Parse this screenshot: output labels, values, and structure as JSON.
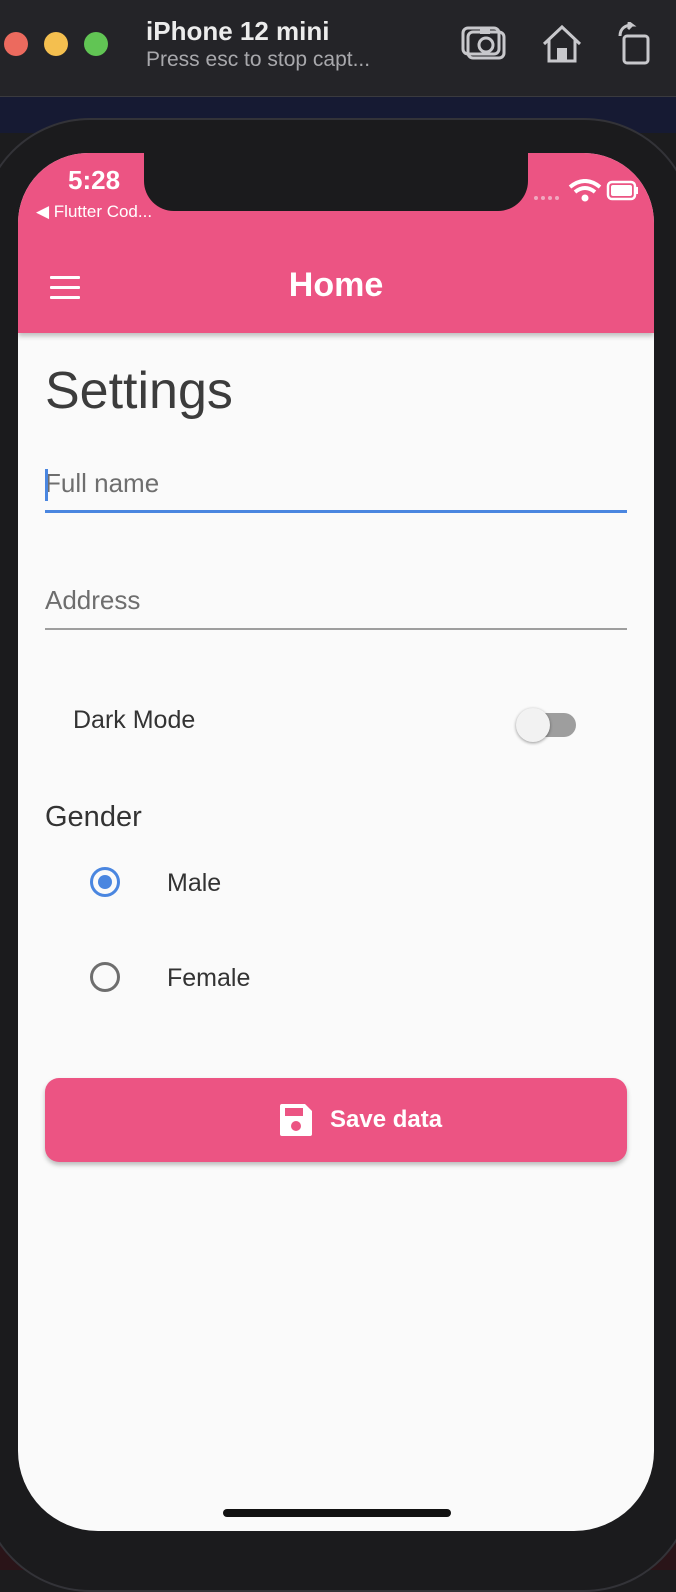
{
  "simulator": {
    "device_name": "iPhone 12 mini",
    "subtitle": "Press esc to stop capt...",
    "icons": [
      "screenshot-icon",
      "home-icon",
      "rotate-icon"
    ]
  },
  "status_bar": {
    "time": "5:28",
    "back_label": "◀ Flutter Cod...",
    "icons": [
      "wifi-icon",
      "battery-icon"
    ]
  },
  "app_bar": {
    "title": "Home",
    "menu_icon": "menu-icon",
    "color": "#ec5483"
  },
  "page": {
    "title": "Settings"
  },
  "form": {
    "full_name": {
      "placeholder": "Full name",
      "value": ""
    },
    "address": {
      "placeholder": "Address",
      "value": ""
    },
    "dark_mode": {
      "label": "Dark Mode",
      "enabled": false
    },
    "gender": {
      "label": "Gender",
      "options": [
        {
          "label": "Male",
          "selected": true
        },
        {
          "label": "Female",
          "selected": false
        }
      ]
    },
    "save_button": {
      "label": "Save data",
      "icon": "save-icon"
    }
  },
  "colors": {
    "accent": "#ec5483",
    "focus": "#4a86e0"
  }
}
